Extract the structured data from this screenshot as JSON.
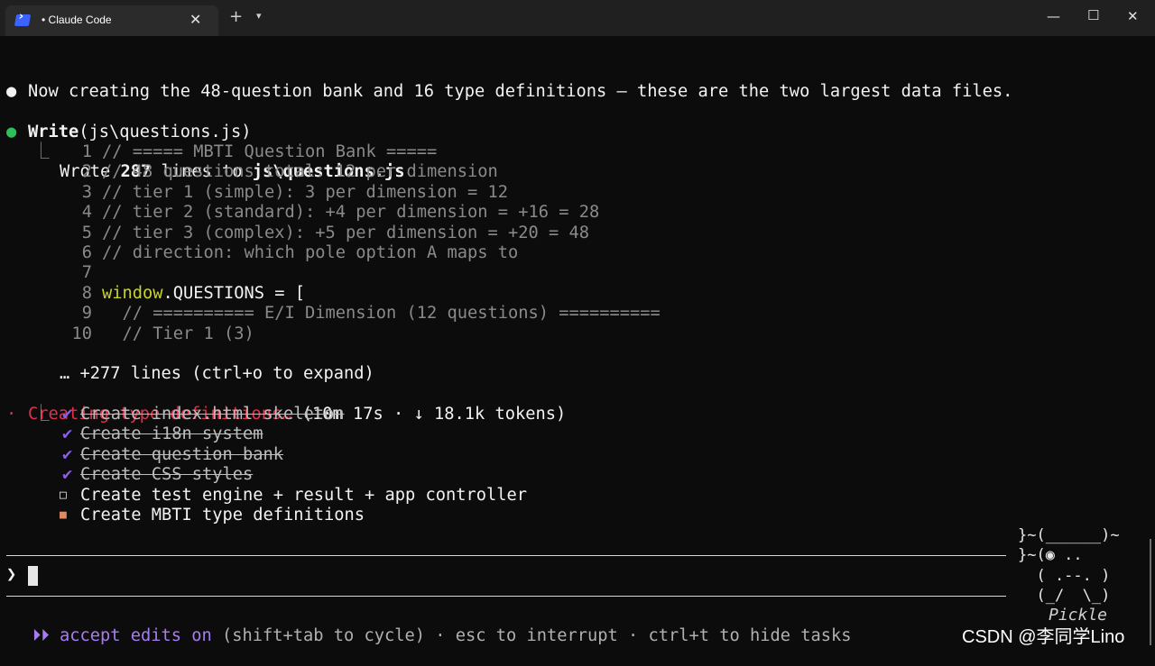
{
  "window": {
    "tab_title": "• Claude Code",
    "tab_close": "✕",
    "new_tab": "+",
    "dropdown": "⌄",
    "minimize": "—",
    "maximize": "☐",
    "close": "✕"
  },
  "messages": {
    "intro_bullet": "●",
    "intro": "Now creating the 48-question bank and 16 type definitions — these are the two largest data files.",
    "write_bullet": "●",
    "write_tool": "Write",
    "write_arg": "(js\\questions.js)",
    "result_corner": "⎿",
    "result_prefix": "Wrote ",
    "result_count": "287",
    "result_mid": " lines to ",
    "result_file": "js\\questions.js",
    "code_lines": [
      {
        "num": "1",
        "text": "// ===== MBTI Question Bank ====="
      },
      {
        "num": "2",
        "text": "// 48 questions total: 12 per dimension"
      },
      {
        "num": "3",
        "text": "// tier 1 (simple): 3 per dimension = 12"
      },
      {
        "num": "4",
        "text": "// tier 2 (standard): +4 per dimension = +16 = 28"
      },
      {
        "num": "5",
        "text": "// tier 3 (complex): +5 per dimension = +20 = 48"
      },
      {
        "num": "6",
        "text": "// direction: which pole option A maps to"
      },
      {
        "num": "7",
        "text": ""
      },
      {
        "num": "8",
        "kw": "window",
        "text": ".QUESTIONS = ["
      },
      {
        "num": "9",
        "text": "  // ========== E/I Dimension (12 questions) =========="
      },
      {
        "num": "10",
        "text": "  // Tier 1 (3)"
      }
    ],
    "expand_hint": "… +277 lines (ctrl+o to expand)"
  },
  "status": {
    "dot": "·",
    "title": "Creating type definitions…",
    "meta": " (10m 17s · ↓ 18.1k tokens)"
  },
  "tasks": {
    "corner": "⎿",
    "items": [
      {
        "mark": "✔",
        "label": "Create index.html skeleton",
        "state": "done"
      },
      {
        "mark": "✔",
        "label": "Create i18n system",
        "state": "done"
      },
      {
        "mark": "✔",
        "label": "Create question bank",
        "state": "done"
      },
      {
        "mark": "✔",
        "label": "Create CSS styles",
        "state": "done"
      },
      {
        "mark": "□",
        "label": "Create test engine + result + app controller",
        "state": "pending"
      },
      {
        "mark": "■",
        "label": "Create MBTI type definitions",
        "state": "in_progress"
      }
    ]
  },
  "input": {
    "prompt": "❯"
  },
  "footer": {
    "arrows": "⏵⏵",
    "mode": "accept edits on",
    "hint": " (shift+tab to cycle) · esc to interrupt · ctrl+t to hide tasks"
  },
  "mascot": {
    "lines": [
      "}~(______)~",
      "}~(◉ ..   ",
      "  ( .--. )",
      "  (_/  \\_)"
    ],
    "name": "Pickle"
  },
  "watermark": "CSDN @李同学Lino"
}
